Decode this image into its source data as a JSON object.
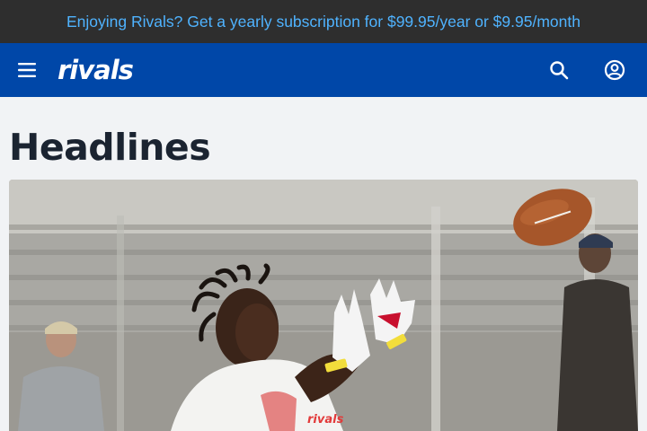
{
  "promo": {
    "text": "Enjoying Rivals? Get a yearly subscription for $99.95/year or $9.95/month"
  },
  "header": {
    "logo_text": "rivals",
    "menu_icon": "hamburger-menu-icon",
    "search_icon": "search-icon",
    "account_icon": "account-circle-icon"
  },
  "main": {
    "title": "Headlines",
    "hero_image_logo_text": "rivals"
  },
  "colors": {
    "promo_bg": "#2e2e2e",
    "promo_text": "#4fb3ff",
    "header_bg": "#0047a8",
    "page_bg": "#f1f3f5",
    "title_text": "#1b2431"
  }
}
